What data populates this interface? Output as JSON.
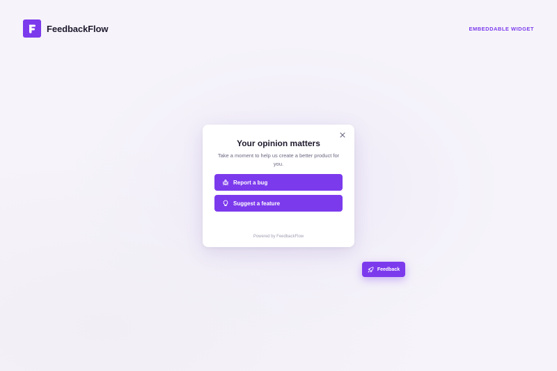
{
  "header": {
    "brand_name": "FeedbackFlow",
    "logo_icon": "f-logo-icon",
    "tagline": "EMBEDDABLE WIDGET"
  },
  "modal": {
    "title": "Your opinion matters",
    "subtitle": "Take a moment to help us create a better product for you.",
    "close_icon": "close-icon",
    "buttons": [
      {
        "label": "Report a bug",
        "icon": "bug-icon"
      },
      {
        "label": "Suggest a feature",
        "icon": "lightbulb-icon"
      }
    ],
    "powered_by": "Powered by FeedbackFlow"
  },
  "fab": {
    "label": "Feedback",
    "icon": "rocket-icon"
  },
  "colors": {
    "accent": "#7c3aed",
    "background": "#f6f4fa",
    "text_dark": "#1f1a2e",
    "text_muted": "#6b6680"
  }
}
